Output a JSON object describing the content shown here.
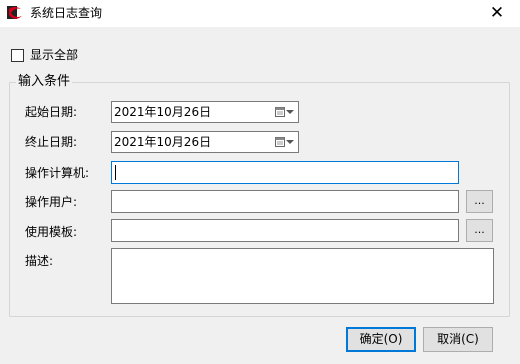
{
  "window": {
    "title": "系统日志查询",
    "close_glyph": "✕"
  },
  "show_all": {
    "label": "显示全部",
    "checked": false
  },
  "conditions": {
    "group_title": "输入条件",
    "start_date": {
      "label": "起始日期:",
      "value": "2021年10月26日"
    },
    "end_date": {
      "label": "终止日期:",
      "value": "2021年10月26日"
    },
    "computer": {
      "label": "操作计算机:",
      "value": ""
    },
    "user": {
      "label": "操作用户:",
      "value": "",
      "browse": "..."
    },
    "template": {
      "label": "使用模板:",
      "value": "",
      "browse": "..."
    },
    "description": {
      "label": "描述:",
      "value": ""
    }
  },
  "buttons": {
    "ok": "确定(O)",
    "cancel": "取消(C)"
  },
  "colors": {
    "accent": "#0078d7",
    "app_icon_red": "#d6001c"
  }
}
